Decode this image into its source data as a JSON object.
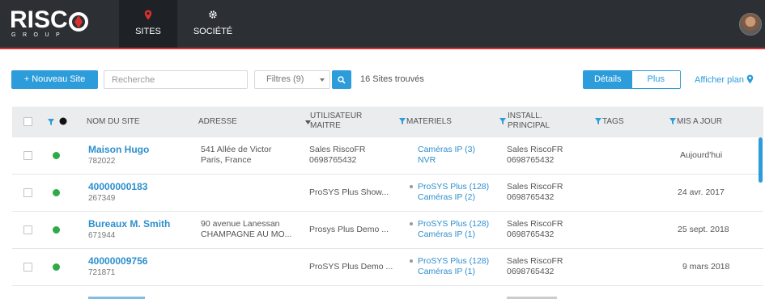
{
  "brand": {
    "logo_text": "RISC",
    "logo_sub": "GROUP"
  },
  "nav": {
    "tabs": [
      {
        "label": "SITES",
        "icon": "map-pin-icon",
        "active": true
      },
      {
        "label": "SOCIÉTÉ",
        "icon": "gear-icon",
        "active": false
      }
    ]
  },
  "toolbar": {
    "new_site_label": "+ Nouveau Site",
    "search_placeholder": "Recherche",
    "filter_label": "Filtres (9)",
    "result_count": "16 Sites trouvés",
    "view_details": "Détails",
    "view_more": "Plus",
    "show_map": "Afficher plan"
  },
  "table": {
    "headers": {
      "site_name": "NOM DU SITE",
      "address": "ADRESSE",
      "master_user_1": "UTILISATEUR",
      "master_user_2": "MAITRE",
      "hardware": "MATERIELS",
      "installer_1": "INSTALL.",
      "installer_2": "PRINCIPAL",
      "tags": "TAGS",
      "updated": "MIS A JOUR"
    },
    "rows": [
      {
        "name": "Maison Hugo",
        "id": "782022",
        "address_1": "541 Allée de Victor",
        "address_2": "Paris, France",
        "user_1": "Sales RiscoFR",
        "user_2": "0698765432",
        "hw_1": "Caméras IP (3)",
        "hw_2": "NVR",
        "hw_bullet": false,
        "inst_1": "Sales RiscoFR",
        "inst_2": "0698765432",
        "updated": "Aujourd'hui"
      },
      {
        "name": "40000000183",
        "id": "267349",
        "address_1": "",
        "address_2": "",
        "user_1": "ProSYS Plus Show...",
        "user_2": "",
        "hw_1": "ProSYS Plus (128)",
        "hw_2": "Caméras IP (2)",
        "hw_bullet": true,
        "inst_1": "Sales RiscoFR",
        "inst_2": "0698765432",
        "updated": "24 avr. 2017"
      },
      {
        "name": "Bureaux M. Smith",
        "id": "671944",
        "address_1": "90 avenue Lanessan",
        "address_2": "CHAMPAGNE AU MO...",
        "user_1": "Prosys Plus Demo ...",
        "user_2": "",
        "hw_1": "ProSYS Plus (128)",
        "hw_2": "Caméras IP (1)",
        "hw_bullet": true,
        "inst_1": "Sales RiscoFR",
        "inst_2": "0698765432",
        "updated": "25 sept. 2018"
      },
      {
        "name": "40000009756",
        "id": "721871",
        "address_1": "",
        "address_2": "",
        "user_1": "ProSYS Plus Demo ...",
        "user_2": "",
        "hw_1": "ProSYS Plus (128)",
        "hw_2": "Caméras IP (1)",
        "hw_bullet": true,
        "inst_1": "Sales RiscoFR",
        "inst_2": "0698765432",
        "updated": "9 mars 2018"
      }
    ]
  },
  "colors": {
    "accent": "#2d9cdb",
    "topbar": "#2c3035",
    "online": "#2eaa48",
    "brand_red": "#d8312f"
  }
}
